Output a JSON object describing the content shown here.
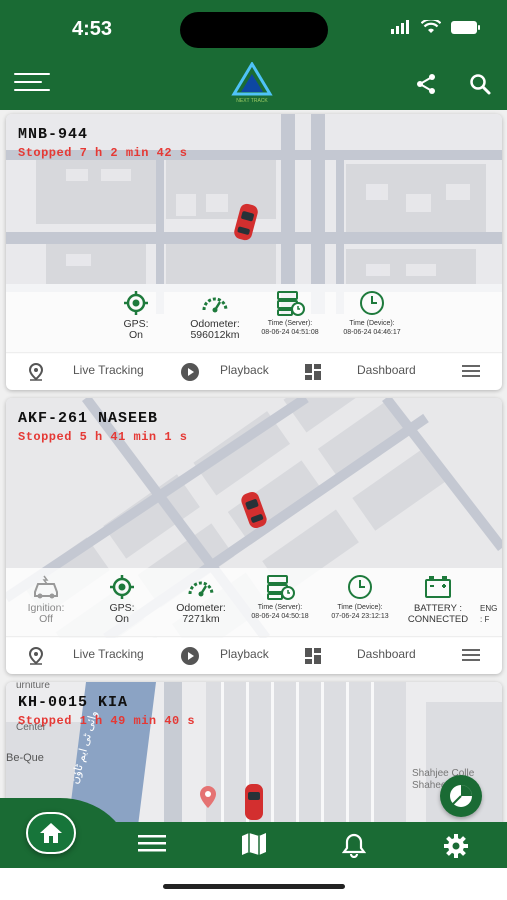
{
  "status_bar": {
    "time": "4:53"
  },
  "header": {
    "menu_icon": "hamburger-menu-icon",
    "logo_text": "NEXT TRACK",
    "share_icon": "share-icon",
    "search_icon": "search-icon"
  },
  "vehicles": [
    {
      "name": "MNB-944",
      "status": "Stopped 7 h 2 min 42 s",
      "stats": {
        "gps": "GPS:",
        "gps_value": "On",
        "odometer": "Odometer:",
        "odometer_value": "596012km",
        "time_server": "Time (Server):",
        "time_server_value": "08-06-24 04:51:08",
        "time_device": "Time (Device):",
        "time_device_value": "08-06-24 04:46:17"
      },
      "actions": {
        "live": "Live Tracking",
        "playback": "Playback",
        "dashboard": "Dashboard"
      }
    },
    {
      "name": "AKF-261 NASEEB",
      "status": "Stopped 5 h 41 min 1 s",
      "stats": {
        "ignition": "Ignition:",
        "ignition_value": "Off",
        "gps": "GPS:",
        "gps_value": "On",
        "odometer": "Odometer:",
        "odometer_value": "7271km",
        "time_server": "Time (Server):",
        "time_server_value": "08-06-24 04:50:18",
        "time_device": "Time (Device):",
        "time_device_value": "07-06-24 23:12:13",
        "battery": "BATTERY :",
        "battery_value": "CONNECTED",
        "engine": "ENG",
        "engine_value": ": F"
      },
      "actions": {
        "live": "Live Tracking",
        "playback": "Playback",
        "dashboard": "Dashboard"
      }
    },
    {
      "name": "KH-0015 KIA",
      "status": "Stopped 1 h 49 min 40 s",
      "map_labels": {
        "furniture": "urniture",
        "center": "Center",
        "be_que": "Be-Que",
        "shaheen1": "Shahjee Colle",
        "shaheen2": "Shaheen C",
        "urdu_street": "وائی ٹی ایم ٹاؤن"
      }
    }
  ],
  "bottom_nav": [
    "home-icon",
    "menu-icon",
    "map-icon",
    "bell-icon",
    "settings-icon"
  ],
  "colors": {
    "primary": "#1a6b34",
    "status_red": "#e53935",
    "icon_green": "#1e7a3c"
  }
}
